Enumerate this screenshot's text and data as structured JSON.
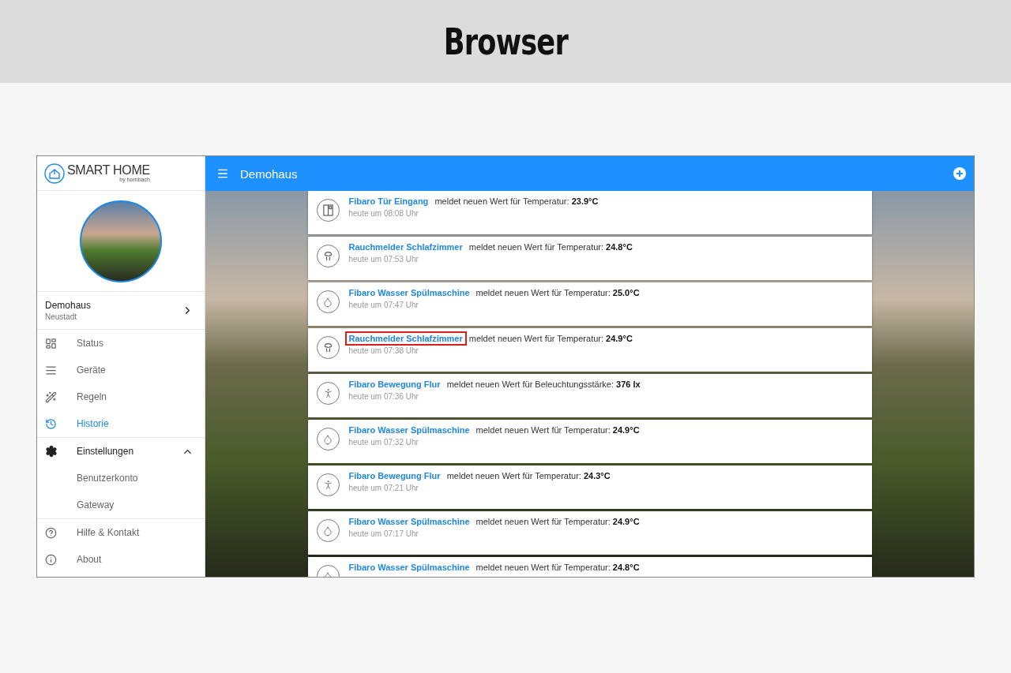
{
  "page_title": "Browser",
  "app": {
    "logo": {
      "name": "SMART HOME",
      "tagline": "by hornbach"
    },
    "topbar": {
      "title": "Demohaus"
    },
    "home": {
      "name": "Demohaus",
      "location": "Neustadt"
    },
    "nav": [
      {
        "label": "Status",
        "kind": "dashboard",
        "selected": false
      },
      {
        "label": "Geräte",
        "kind": "list",
        "selected": false
      },
      {
        "label": "Regeln",
        "kind": "wand",
        "selected": false
      },
      {
        "label": "Historie",
        "kind": "history",
        "selected": true
      }
    ],
    "settings": {
      "label": "Einstellungen",
      "expanded": true,
      "children": [
        {
          "label": "Benutzerkonto"
        },
        {
          "label": "Gateway"
        }
      ]
    },
    "footer_nav": [
      {
        "label": "Hilfe & Kontakt",
        "kind": "help"
      },
      {
        "label": "About",
        "kind": "info"
      }
    ],
    "events": [
      {
        "kind": "door",
        "device": "Fibaro Tür Eingang",
        "message": "meldet neuen Wert für Temperatur: **23.9°C**",
        "time": "heute um 08:08 Uhr",
        "highlighted": false
      },
      {
        "kind": "smoke",
        "device": "Rauchmelder Schlafzimmer",
        "message": "meldet neuen Wert für Temperatur: **24.8°C**",
        "time": "heute um 07:53 Uhr",
        "highlighted": false
      },
      {
        "kind": "water",
        "device": "Fibaro Wasser Spülmaschine",
        "message": "meldet neuen Wert für Temperatur: **25.0°C**",
        "time": "heute um 07:47 Uhr",
        "highlighted": false
      },
      {
        "kind": "smoke",
        "device": "Rauchmelder Schlafzimmer",
        "message": "meldet neuen Wert für Temperatur: **24.9°C**",
        "time": "heute um 07:38 Uhr",
        "highlighted": true
      },
      {
        "kind": "motion",
        "device": "Fibaro Bewegung Flur",
        "message": "meldet neuen Wert für Beleuchtungsstärke: **376 lx**",
        "time": "heute um 07:36 Uhr",
        "highlighted": false
      },
      {
        "kind": "water",
        "device": "Fibaro Wasser Spülmaschine",
        "message": "meldet neuen Wert für Temperatur: **24.9°C**",
        "time": "heute um 07:32 Uhr",
        "highlighted": false
      },
      {
        "kind": "motion",
        "device": "Fibaro Bewegung Flur",
        "message": "meldet neuen Wert für Temperatur: **24.3°C**",
        "time": "heute um 07:21 Uhr",
        "highlighted": false
      },
      {
        "kind": "water",
        "device": "Fibaro Wasser Spülmaschine",
        "message": "meldet neuen Wert für Temperatur: **24.9°C**",
        "time": "heute um 07:17 Uhr",
        "highlighted": false
      },
      {
        "kind": "water",
        "device": "Fibaro Wasser Spülmaschine",
        "message": "meldet neuen Wert für Temperatur: **24.8°C**",
        "highlighted": false
      }
    ]
  }
}
